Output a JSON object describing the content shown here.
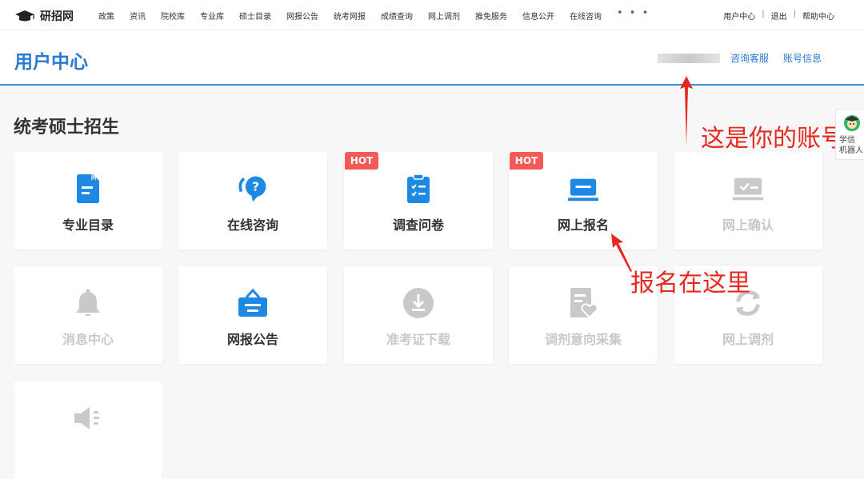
{
  "topnav": {
    "logo_text": "研招网",
    "items": [
      "政策",
      "资讯",
      "院校库",
      "专业库",
      "硕士目录",
      "网报公告",
      "统考网报",
      "成绩查询",
      "网上调剂",
      "推免服务",
      "信息公开",
      "在线咨询"
    ],
    "more": "• • •",
    "right": [
      "用户中心",
      "退出",
      "帮助中心"
    ],
    "separator": "|"
  },
  "header": {
    "title": "用户中心",
    "links": [
      "咨询客服",
      "账号信息"
    ]
  },
  "section_title": "统考硕士招生",
  "colors": {
    "accent": "#2a7ad2",
    "icon_active": "#1e88e5",
    "icon_disabled": "#c9c9c9",
    "hot": "#f25a5a",
    "annotation": "#e5291f"
  },
  "cards": [
    {
      "label": "专业目录",
      "icon": "document-icon",
      "enabled": true,
      "hot": false
    },
    {
      "label": "在线咨询",
      "icon": "chat-question-icon",
      "enabled": true,
      "hot": false
    },
    {
      "label": "调查问卷",
      "icon": "clipboard-checklist-icon",
      "enabled": true,
      "hot": true
    },
    {
      "label": "网上报名",
      "icon": "laptop-icon",
      "enabled": true,
      "hot": true
    },
    {
      "label": "网上确认",
      "icon": "confirm-monitor-icon",
      "enabled": false,
      "hot": false
    },
    {
      "label": "消息中心",
      "icon": "bell-icon",
      "enabled": false,
      "hot": false
    },
    {
      "label": "网报公告",
      "icon": "notice-board-icon",
      "enabled": true,
      "hot": false
    },
    {
      "label": "准考证下载",
      "icon": "download-icon",
      "enabled": false,
      "hot": false
    },
    {
      "label": "调剂意向采集",
      "icon": "form-heart-icon",
      "enabled": false,
      "hot": false
    },
    {
      "label": "网上调剂",
      "icon": "refresh-icon",
      "enabled": false,
      "hot": false
    },
    {
      "label": "",
      "icon": "speaker-icon",
      "enabled": false,
      "hot": false
    }
  ],
  "hot_label": "HOT",
  "annotations": {
    "account": "这是你的账号",
    "register": "报名在这里"
  },
  "robot": {
    "text_line1": "学信",
    "text_line2": "机器人"
  }
}
